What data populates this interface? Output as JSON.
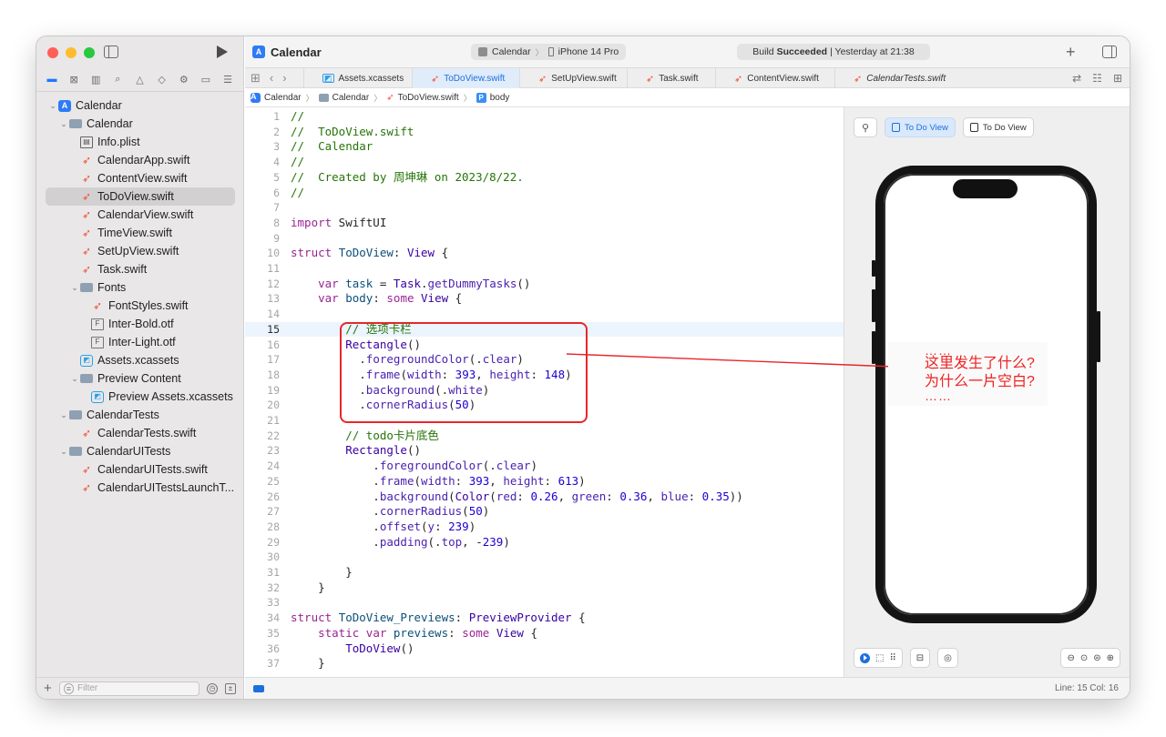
{
  "window": {
    "traffic_colors": [
      "#fe5f57",
      "#febc2e",
      "#28c840"
    ]
  },
  "sidebar": {
    "nav_icons": [
      "folder-icon",
      "source-control-icon",
      "symbol-icon",
      "find-icon",
      "issue-icon",
      "test-icon",
      "debug-icon",
      "breakpoint-icon",
      "report-icon"
    ],
    "tree": [
      {
        "label": "Calendar",
        "level": 0,
        "kind": "proj",
        "expanded": true
      },
      {
        "label": "Calendar",
        "level": 1,
        "kind": "folder",
        "expanded": true
      },
      {
        "label": "Info.plist",
        "level": 2,
        "kind": "plist"
      },
      {
        "label": "CalendarApp.swift",
        "level": 2,
        "kind": "swift"
      },
      {
        "label": "ContentView.swift",
        "level": 2,
        "kind": "swift"
      },
      {
        "label": "ToDoView.swift",
        "level": 2,
        "kind": "swift",
        "selected": true
      },
      {
        "label": "CalendarView.swift",
        "level": 2,
        "kind": "swift"
      },
      {
        "label": "TimeView.swift",
        "level": 2,
        "kind": "swift"
      },
      {
        "label": "SetUpView.swift",
        "level": 2,
        "kind": "swift"
      },
      {
        "label": "Task.swift",
        "level": 2,
        "kind": "swift"
      },
      {
        "label": "Fonts",
        "level": 2,
        "kind": "folder",
        "expanded": true
      },
      {
        "label": "FontStyles.swift",
        "level": 3,
        "kind": "swift"
      },
      {
        "label": "Inter-Bold.otf",
        "level": 3,
        "kind": "font"
      },
      {
        "label": "Inter-Light.otf",
        "level": 3,
        "kind": "font"
      },
      {
        "label": "Assets.xcassets",
        "level": 2,
        "kind": "assets"
      },
      {
        "label": "Preview Content",
        "level": 2,
        "kind": "folder",
        "expanded": true
      },
      {
        "label": "Preview Assets.xcassets",
        "level": 3,
        "kind": "assets"
      },
      {
        "label": "CalendarTests",
        "level": 1,
        "kind": "folder",
        "expanded": true
      },
      {
        "label": "CalendarTests.swift",
        "level": 2,
        "kind": "swift"
      },
      {
        "label": "CalendarUITests",
        "level": 1,
        "kind": "folder",
        "expanded": true
      },
      {
        "label": "CalendarUITests.swift",
        "level": 2,
        "kind": "swift"
      },
      {
        "label": "CalendarUITestsLaunchT...",
        "level": 2,
        "kind": "swift"
      }
    ],
    "filter_placeholder": "Filter"
  },
  "toolbar": {
    "project_title": "Calendar",
    "scheme": "Calendar",
    "device": "iPhone 14 Pro",
    "build_prefix": "Build",
    "build_status": "Succeeded",
    "build_time": "| Yesterday at 21:38"
  },
  "tabs": [
    {
      "label": "Assets.xcassets",
      "kind": "assets"
    },
    {
      "label": "ToDoView.swift",
      "kind": "swift",
      "active": true
    },
    {
      "label": "SetUpView.swift",
      "kind": "swift"
    },
    {
      "label": "Task.swift",
      "kind": "swift"
    },
    {
      "label": "ContentView.swift",
      "kind": "swift"
    },
    {
      "label": "CalendarTests.swift",
      "kind": "swift",
      "italic": true
    }
  ],
  "jumpbar": {
    "items": [
      "Calendar",
      "Calendar",
      "ToDoView.swift",
      "body"
    ]
  },
  "editor": {
    "current_line": 15,
    "lines": [
      "<c>//</c>",
      "<c>//  ToDoView.swift</c>",
      "<c>//  Calendar</c>",
      "<c>//</c>",
      "<c>//  Created by 周坤琳 on 2023/8/22.</c>",
      "<c>//</c>",
      "",
      "<k>import</k> SwiftUI",
      "",
      "<k>struct</k> <ty>ToDoView</ty>: <t>View</t> {",
      "",
      "    <k>var</k> <ty>task</ty> = <t>Task</t>.<pr>getDummyTasks</pr>()",
      "    <k>var</k> <ty>body</ty>: <k>some</k> <t>View</t> {",
      "",
      "        <c>// 选项卡栏</c>",
      "        <t>Rectangle</t>()",
      "          .<pr>foregroundColor</pr>(.<pr>clear</pr>)",
      "          .<pr>frame</pr>(<pr>width</pr>: <n>393</n>, <pr>height</pr>: <n>148</n>)",
      "          .<pr>background</pr>(.<pr>white</pr>)",
      "          .<pr>cornerRadius</pr>(<n>50</n>)",
      "",
      "        <c>// todo卡片底色</c>",
      "        <t>Rectangle</t>()",
      "            .<pr>foregroundColor</pr>(.<pr>clear</pr>)",
      "            .<pr>frame</pr>(<pr>width</pr>: <n>393</n>, <pr>height</pr>: <n>613</n>)",
      "            .<pr>background</pr>(<t>Color</t>(<pr>red</pr>: <n>0.26</n>, <pr>green</pr>: <n>0.36</n>, <pr>blue</pr>: <n>0.35</n>))",
      "            .<pr>cornerRadius</pr>(<n>50</n>)",
      "            .<pr>offset</pr>(<pr>y</pr>: <n>239</n>)",
      "            .<pr>padding</pr>(.<pr>top</pr>, -<n>239</n>)",
      "",
      "        }",
      "    }",
      "",
      "<k>struct</k> <ty>ToDoView_Previews</ty>: <t>PreviewProvider</t> {",
      "    <k>static</k> <k>var</k> <ty>previews</ty>: <k>some</k> <t>View</t> {",
      "        <t>ToDoView</t>()",
      "    }"
    ]
  },
  "preview": {
    "variant_active": "To Do View",
    "variant_other": "To Do View"
  },
  "annotation": {
    "dots_top": "……",
    "line1": "这里发生了什么?",
    "line2": "为什么一片空白?",
    "dots_bottom": "……",
    "color": "#e8262a"
  },
  "statusbar": {
    "cursor": "Line: 15  Col: 16"
  }
}
